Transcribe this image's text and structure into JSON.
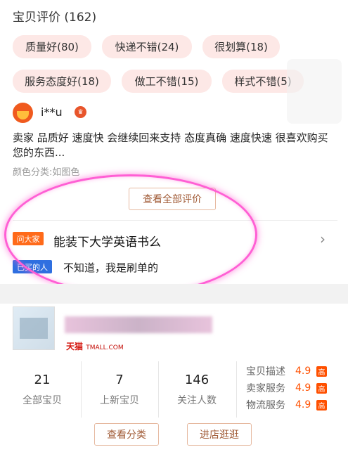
{
  "reviews": {
    "title": "宝贝评价 (162)",
    "tags": [
      "质量好(80)",
      "快递不错(24)",
      "很划算(18)",
      "服务态度好(18)",
      "做工不错(15)",
      "样式不错(5)"
    ],
    "review": {
      "avatar_icon": "user-avatar-icon",
      "username": "i**u",
      "vip_icon": "vip-badge-icon",
      "text": "卖家 品质好 速度快 会继续回来支持 态度真确 速度快速 很喜欢购买您的东西...",
      "meta": "颜色分类:如图色"
    },
    "view_all_label": "查看全部评价"
  },
  "qa": {
    "badge": "问大家",
    "question": "能装下大学英语书么",
    "chevron": "›",
    "buyer_badge": "已买的人",
    "answer": "不知道，我是刷单的",
    "highlight_color": "#ff5fd4"
  },
  "shop": {
    "tmall_label": "天猫",
    "tmall_domain": "TMALL.COM",
    "stats": [
      {
        "value": "21",
        "label": "全部宝贝"
      },
      {
        "value": "7",
        "label": "上新宝贝"
      },
      {
        "value": "146",
        "label": "关注人数"
      }
    ],
    "ratings": [
      {
        "label": "宝贝描述",
        "score": "4.9",
        "level": "高"
      },
      {
        "label": "卖家服务",
        "score": "4.9",
        "level": "高"
      },
      {
        "label": "物流服务",
        "score": "4.9",
        "level": "高"
      }
    ],
    "buttons": {
      "category": "查看分类",
      "visit": "进店逛逛"
    }
  },
  "colors": {
    "accent": "#ff5000",
    "tag_bg": "#fde8e6",
    "tmall_red": "#d4120a"
  }
}
